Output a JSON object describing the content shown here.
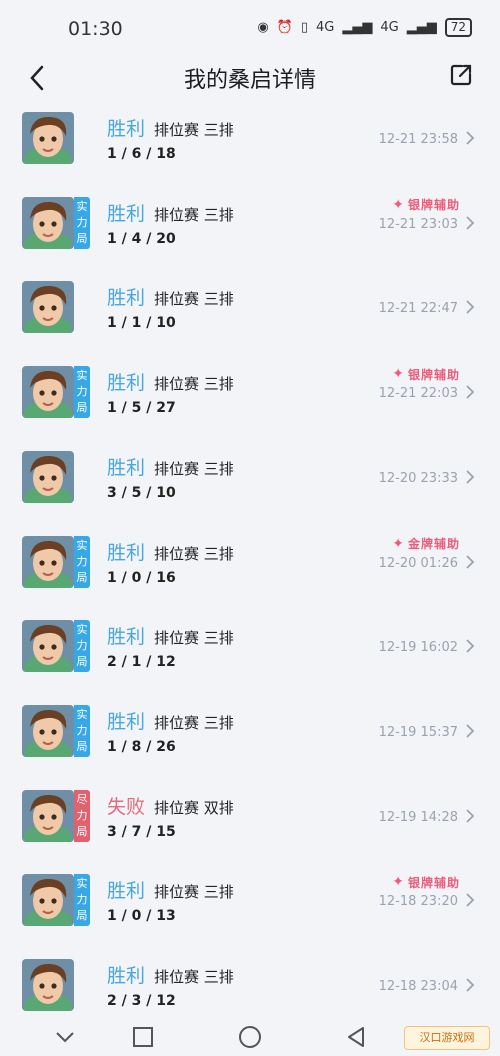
{
  "status_bar": {
    "time": "01:30",
    "net_1": "4G",
    "net_2": "4G",
    "battery": "72"
  },
  "header": {
    "title": "我的桑启详情"
  },
  "matches": [
    {
      "result": "胜利",
      "result_type": "win",
      "mode": "排位赛 三排",
      "kda": "1 / 6 / 18",
      "time": "12-21 23:58",
      "tag": null,
      "rank": null
    },
    {
      "result": "胜利",
      "result_type": "win",
      "mode": "排位赛 三排",
      "kda": "1 / 4 / 20",
      "time": "12-21 23:03",
      "tag": "实力局",
      "tag_color": "blue",
      "rank": "银牌辅助"
    },
    {
      "result": "胜利",
      "result_type": "win",
      "mode": "排位赛 三排",
      "kda": "1 / 1 / 10",
      "time": "12-21 22:47",
      "tag": null,
      "rank": null
    },
    {
      "result": "胜利",
      "result_type": "win",
      "mode": "排位赛 三排",
      "kda": "1 / 5 / 27",
      "time": "12-21 22:03",
      "tag": "实力局",
      "tag_color": "blue",
      "rank": "银牌辅助"
    },
    {
      "result": "胜利",
      "result_type": "win",
      "mode": "排位赛 三排",
      "kda": "3 / 5 / 10",
      "time": "12-20 23:33",
      "tag": null,
      "rank": null
    },
    {
      "result": "胜利",
      "result_type": "win",
      "mode": "排位赛 三排",
      "kda": "1 / 0 / 16",
      "time": "12-20 01:26",
      "tag": "实力局",
      "tag_color": "blue",
      "rank": "金牌辅助"
    },
    {
      "result": "胜利",
      "result_type": "win",
      "mode": "排位赛 三排",
      "kda": "2 / 1 / 12",
      "time": "12-19 16:02",
      "tag": "实力局",
      "tag_color": "blue",
      "rank": null
    },
    {
      "result": "胜利",
      "result_type": "win",
      "mode": "排位赛 三排",
      "kda": "1 / 8 / 26",
      "time": "12-19 15:37",
      "tag": "实力局",
      "tag_color": "blue",
      "rank": null
    },
    {
      "result": "失败",
      "result_type": "loss",
      "mode": "排位赛 双排",
      "kda": "3 / 7 / 15",
      "time": "12-19 14:28",
      "tag": "尽力局",
      "tag_color": "red",
      "rank": null
    },
    {
      "result": "胜利",
      "result_type": "win",
      "mode": "排位赛 三排",
      "kda": "1 / 0 / 13",
      "time": "12-18 23:20",
      "tag": "实力局",
      "tag_color": "blue",
      "rank": "银牌辅助"
    },
    {
      "result": "胜利",
      "result_type": "win",
      "mode": "排位赛 三排",
      "kda": "2 / 3 / 12",
      "time": "12-18 23:04",
      "tag": null,
      "rank": null
    }
  ],
  "watermark": "汉口游戏网",
  "colors": {
    "win": "#49a7df",
    "loss": "#e26c7b",
    "tag_blue": "#37a8e6",
    "tag_red": "#e1616e",
    "badge": "#ee5c7b",
    "time_gray": "#9aa2b0"
  }
}
